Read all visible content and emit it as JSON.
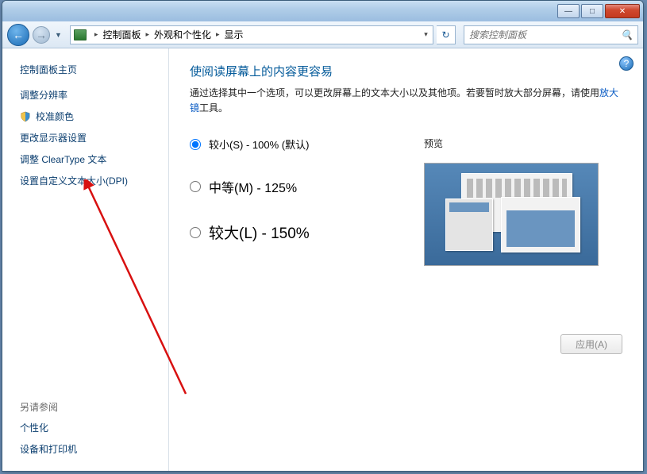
{
  "titlebar": {
    "min": "—",
    "max": "□",
    "close": "✕"
  },
  "toolbar": {
    "back": "←",
    "forward": "→",
    "chevron": "▼",
    "refresh": "↻",
    "search_placeholder": "搜索控制面板",
    "search_icon": "🔍"
  },
  "breadcrumb": {
    "items": [
      "控制面板",
      "外观和个性化",
      "显示"
    ],
    "sep": "▸",
    "drop": "▾"
  },
  "sidebar": {
    "home": "控制面板主页",
    "items": [
      "调整分辨率",
      "校准颜色",
      "更改显示器设置",
      "调整 ClearType 文本",
      "设置自定义文本大小(DPI)"
    ],
    "see_also_title": "另请参阅",
    "see_also": [
      "个性化",
      "设备和打印机"
    ]
  },
  "main": {
    "help": "?",
    "title": "使阅读屏幕上的内容更容易",
    "desc_prefix": "通过选择其中一个选项，可以更改屏幕上的文本大小以及其他项。若要暂时放大部分屏幕，请使用",
    "magnifier_link": "放大镜",
    "desc_suffix": "工具。",
    "options": [
      {
        "label": "较小(S) - 100% (默认)",
        "checked": true
      },
      {
        "label": "中等(M) - 125%",
        "checked": false
      },
      {
        "label": "较大(L) - 150%",
        "checked": false
      }
    ],
    "preview_title": "预览",
    "apply": "应用(A)"
  }
}
